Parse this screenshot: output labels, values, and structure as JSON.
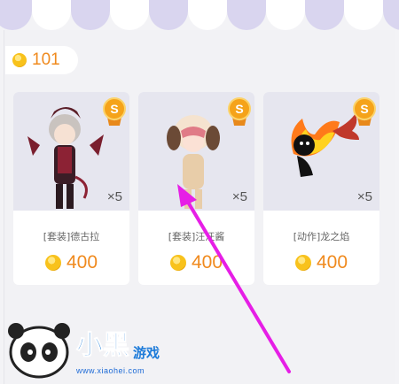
{
  "balance": {
    "value": "101",
    "icon": "coin-icon"
  },
  "items": [
    {
      "badge": "S",
      "qty": "×5",
      "name": "[套装]德古拉",
      "price": "400",
      "image": "dracula-outfit"
    },
    {
      "badge": "S",
      "qty": "×5",
      "name": "[套装]汪汪酱",
      "price": "400",
      "image": "puppy-outfit"
    },
    {
      "badge": "S",
      "qty": "×5",
      "name": "[动作]龙之焰",
      "price": "400",
      "image": "dragon-flame-action"
    }
  ],
  "watermark": {
    "url": "www.xiaohei.com",
    "logo": "小黑游戏"
  },
  "colors": {
    "price": "#f08a1e",
    "arrow": "#e61ee6",
    "badge": "#f5a31a",
    "awning": "#d9d5ef"
  }
}
